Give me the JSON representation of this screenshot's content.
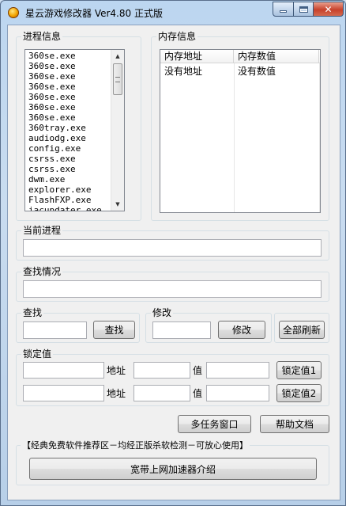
{
  "window": {
    "title": "星云游戏修改器 Ver4.80 正式版",
    "close_glyph": "✕"
  },
  "process_group": {
    "label": "进程信息",
    "items": [
      "360se.exe",
      "360se.exe",
      "360se.exe",
      "360se.exe",
      "360se.exe",
      "360se.exe",
      "360se.exe",
      "360tray.exe",
      "audiodg.exe",
      "config.exe",
      "csrss.exe",
      "csrss.exe",
      "dwm.exe",
      "explorer.exe",
      "FlashFXP.exe",
      "iacupdater.exe"
    ]
  },
  "memory_group": {
    "label": "内存信息",
    "columns": [
      "内存地址",
      "内存数值"
    ],
    "rows": [
      [
        "没有地址",
        "没有数值"
      ]
    ]
  },
  "current_process": {
    "label": "当前进程",
    "value": ""
  },
  "search_status": {
    "label": "查找情况",
    "value": ""
  },
  "search": {
    "label": "查找",
    "value": "",
    "button": "查找"
  },
  "modify": {
    "label": "修改",
    "value": "",
    "button": "修改"
  },
  "refresh_all_button": "全部刷新",
  "lock": {
    "label": "锁定值",
    "address_label": "地址",
    "value_label": "值",
    "rows": [
      {
        "field1": "",
        "address": "",
        "value": "",
        "button": "锁定值1"
      },
      {
        "field1": "",
        "address": "",
        "value": "",
        "button": "锁定值2"
      }
    ]
  },
  "multitask_button": "多任务窗口",
  "help_button": "帮助文档",
  "promo": {
    "text": "【经典免费软件推荐区－均经正版杀软检测－可放心使用】",
    "button": "宽带上网加速器介绍"
  }
}
